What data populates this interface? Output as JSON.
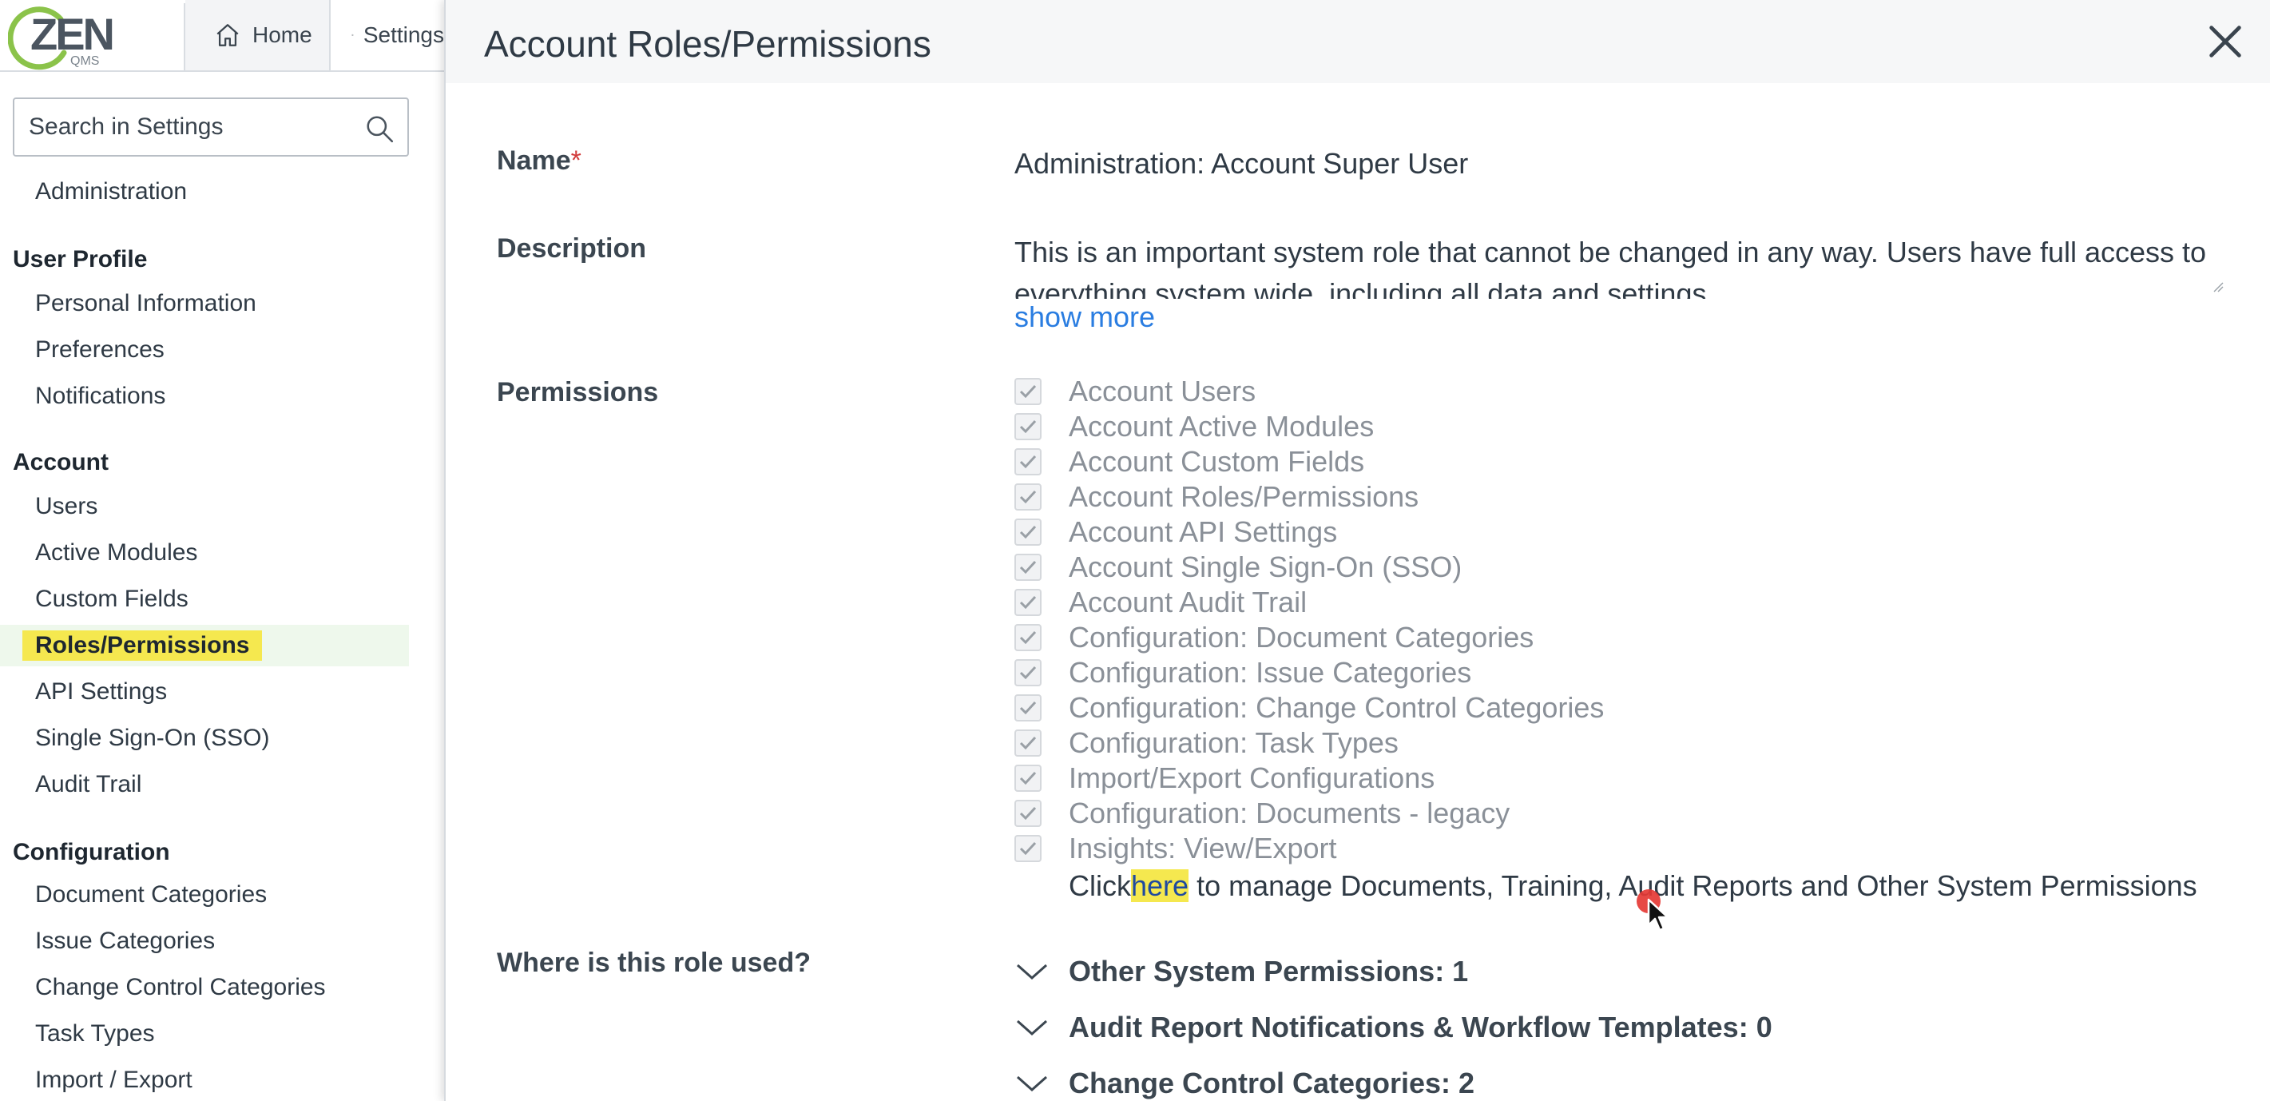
{
  "app": {
    "logo_text": "ZEN",
    "logo_sub": "QMS",
    "tabs": {
      "home": "Home",
      "settings": "Settings"
    }
  },
  "sidebar": {
    "search_placeholder": "Search in Settings",
    "top_item": "Administration",
    "sections": [
      {
        "title": "User Profile",
        "items": [
          "Personal Information",
          "Preferences",
          "Notifications"
        ]
      },
      {
        "title": "Account",
        "items": [
          "Users",
          "Active Modules",
          "Custom Fields",
          "Roles/Permissions",
          "API Settings",
          "Single Sign-On (SSO)",
          "Audit Trail"
        ]
      },
      {
        "title": "Configuration",
        "items": [
          "Document Categories",
          "Issue Categories",
          "Change Control Categories",
          "Task Types",
          "Import / Export"
        ]
      }
    ],
    "active_item": "Roles/Permissions"
  },
  "modal": {
    "title": "Account Roles/Permissions",
    "name_label": "Name",
    "name_required_mark": "*",
    "name_value": "Administration: Account Super User",
    "description_label": "Description",
    "description_value": "This is an important system role that cannot be changed in any way. Users have full access to everything system wide, including all data and settings.",
    "show_more": "show more",
    "permissions_label": "Permissions",
    "permissions": [
      "Account Users",
      "Account Active Modules",
      "Account Custom Fields",
      "Account Roles/Permissions",
      "Account API Settings",
      "Account Single Sign-On (SSO)",
      "Account Audit Trail",
      "Configuration: Document Categories",
      "Configuration: Issue Categories",
      "Configuration: Change Control Categories",
      "Configuration: Task Types",
      "Import/Export Configurations",
      "Configuration: Documents - legacy",
      "Insights: View/Export"
    ],
    "click_prefix": "Click",
    "click_link": "here",
    "click_suffix": "to manage Documents, Training, Audit Reports and Other System Permissions",
    "usage_label": "Where is this role used?",
    "usage_groups": [
      "Other System Permissions: 1",
      "Audit Report Notifications & Workflow Templates: 0",
      "Change Control Categories: 2"
    ]
  },
  "colors": {
    "highlight": "#f5e84f",
    "link": "#2a7de1",
    "active_bg": "#eef8ec",
    "required": "#d23b3b"
  }
}
